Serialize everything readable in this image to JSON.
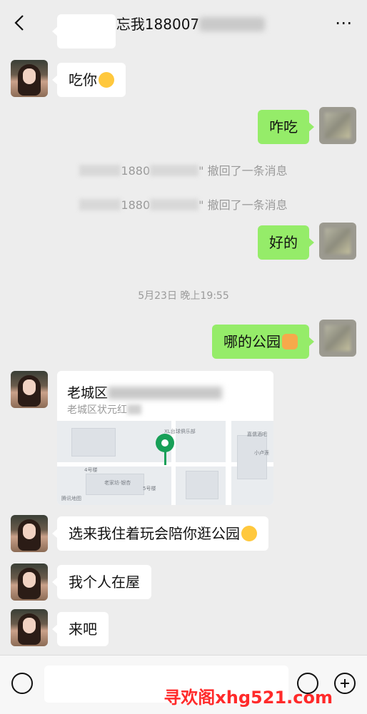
{
  "header": {
    "title": "勿忘我188007",
    "more": "⋯"
  },
  "messages": {
    "m1": "吃你",
    "m2": "咋吃",
    "sys1_num": "1880",
    "sys1_text": "\" 撤回了一条消息",
    "sys2_num": "1880",
    "sys2_text": "\" 撤回了一条消息",
    "m3": "好的",
    "time": "5月23日 晚上19:55",
    "m4": "哪的公园",
    "m5": "选来我住着玩会陪你逛公园",
    "m6": "我个人在屋",
    "m7": "来吧"
  },
  "location": {
    "title": "老城区",
    "subtitle": "老城区状元红",
    "map_labels": [
      "腾讯地图",
      "嘉儒酒吧",
      "小卢莲",
      "XL台球俱乐部",
      "4号楼",
      "5号楼",
      "老家坊·银杏"
    ]
  },
  "watermark": "寻欢阁xhg521.com",
  "colors": {
    "incoming": "#ffffff",
    "outgoing": "#95ec69",
    "background": "#ededed"
  }
}
